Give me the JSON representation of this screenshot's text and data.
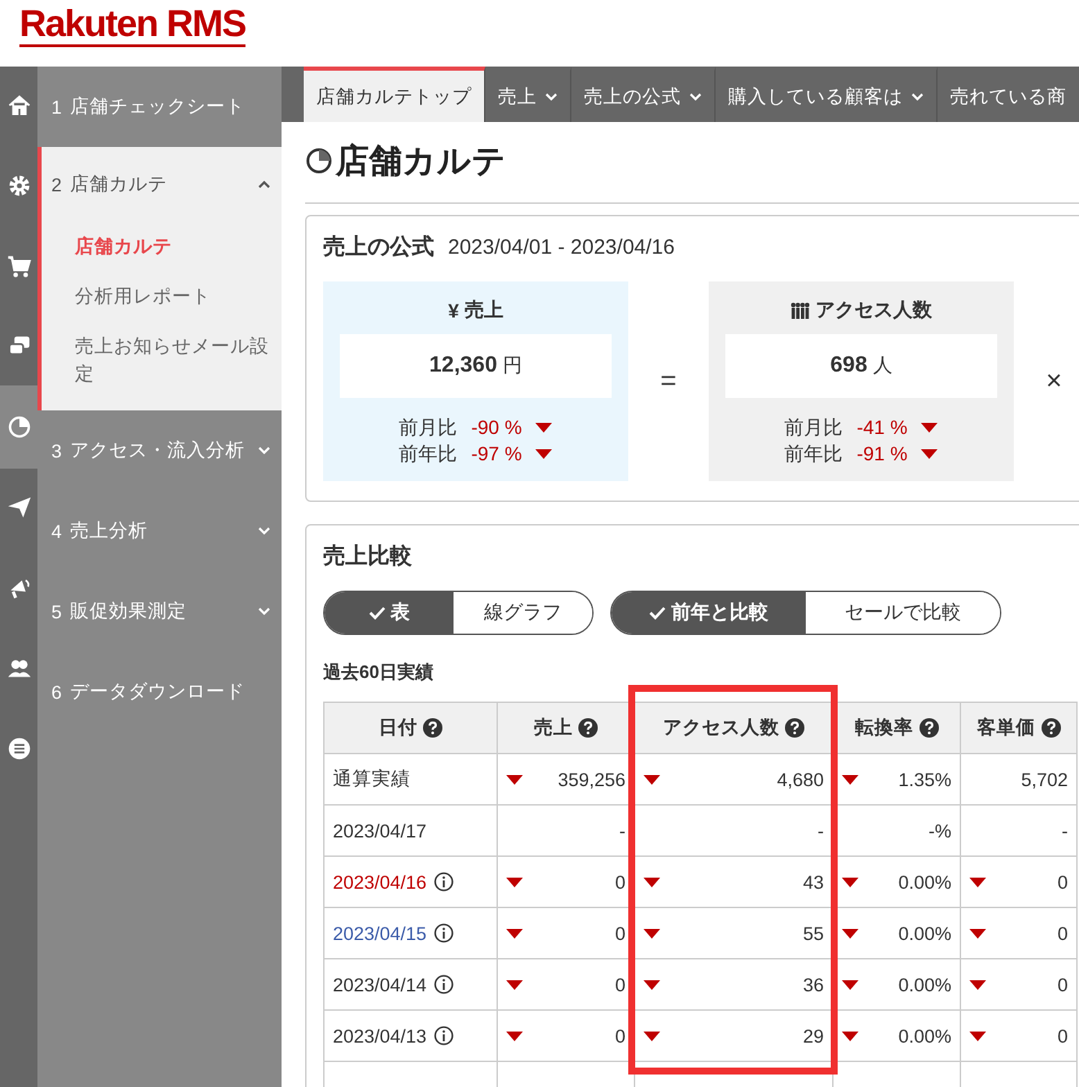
{
  "header": {
    "logo": "Rakuten RMS"
  },
  "rail": [
    {
      "kind": "home",
      "selected": false
    },
    {
      "kind": "gear",
      "selected": false
    },
    {
      "kind": "cart",
      "selected": false
    },
    {
      "kind": "chat",
      "selected": false
    },
    {
      "kind": "pie",
      "selected": true
    },
    {
      "kind": "send",
      "selected": false
    },
    {
      "kind": "megaphone",
      "selected": false
    },
    {
      "kind": "people",
      "selected": false
    },
    {
      "kind": "list",
      "selected": false
    }
  ],
  "sidebar": {
    "items": [
      {
        "number": "1",
        "label": "店舗チェックシート",
        "expanded": false,
        "has_caret": false
      },
      {
        "number": "2",
        "label": "店舗カルテ",
        "expanded": true,
        "has_caret": true,
        "children": [
          {
            "label": "店舗カルテ",
            "selected": true
          },
          {
            "label": "分析用レポート",
            "selected": false
          },
          {
            "label": "売上お知らせメール設定",
            "selected": false
          }
        ]
      },
      {
        "number": "3",
        "label": "アクセス・流入分析",
        "expanded": false,
        "has_caret": true
      },
      {
        "number": "4",
        "label": "売上分析",
        "expanded": false,
        "has_caret": true
      },
      {
        "number": "5",
        "label": "販促効果測定",
        "expanded": false,
        "has_caret": true
      },
      {
        "number": "6",
        "label": "データダウンロード",
        "expanded": false,
        "has_caret": false
      }
    ]
  },
  "tabs": [
    {
      "label": "店舗カルテトップ",
      "selected": true,
      "has_caret": false
    },
    {
      "label": "売上",
      "selected": false,
      "has_caret": true
    },
    {
      "label": "売上の公式",
      "selected": false,
      "has_caret": true
    },
    {
      "label": "購入している顧客は",
      "selected": false,
      "has_caret": true
    },
    {
      "label": "売れている商",
      "selected": false,
      "has_caret": false
    }
  ],
  "page_title": "店舗カルテ",
  "formula": {
    "title": "売上の公式",
    "period": "2023/04/01 - 2023/04/16",
    "boxes": [
      {
        "kind": "sales",
        "icon": "¥",
        "label": "売上",
        "value": "12,360",
        "unit": "円",
        "ratios": [
          {
            "label": "前月比",
            "value": "-90 %",
            "down": true
          },
          {
            "label": "前年比",
            "value": "-97 %",
            "down": true
          }
        ]
      },
      {
        "kind": "access",
        "label": "アクセス人数",
        "value": "698",
        "unit": "人",
        "ratios": [
          {
            "label": "前月比",
            "value": "-41 %",
            "down": true
          },
          {
            "label": "前年比",
            "value": "-91 %",
            "down": true
          }
        ]
      }
    ],
    "operators": [
      "=",
      "×"
    ]
  },
  "comparison": {
    "title": "売上比較",
    "view_toggle": [
      {
        "label": "表",
        "selected": true
      },
      {
        "label": "線グラフ",
        "selected": false
      }
    ],
    "compare_toggle": [
      {
        "label": "前年と比較",
        "selected": true
      },
      {
        "label": "セールで比較",
        "selected": false
      }
    ],
    "subtitle": "過去60日実績",
    "table": {
      "columns": [
        {
          "label": "日付",
          "highlighted": false
        },
        {
          "label": "売上",
          "highlighted": false
        },
        {
          "label": "アクセス人数",
          "highlighted": true
        },
        {
          "label": "転換率",
          "highlighted": false
        },
        {
          "label": "客単価",
          "highlighted": false
        }
      ],
      "rows": [
        {
          "kind": "total",
          "info": false,
          "cells": [
            {
              "value": "通算実績"
            },
            {
              "value": "359,256",
              "down": true
            },
            {
              "value": "4,680",
              "down": true
            },
            {
              "value": "1.35%",
              "down": true
            },
            {
              "value": "5,702",
              "down": false
            }
          ]
        },
        {
          "kind": "weekday",
          "info": false,
          "cells": [
            {
              "value": "2023/04/17"
            },
            {
              "value": "-",
              "down": false
            },
            {
              "value": "-",
              "down": false
            },
            {
              "value": "-%",
              "down": false
            },
            {
              "value": "-",
              "down": false
            }
          ]
        },
        {
          "kind": "sunday",
          "info": true,
          "cells": [
            {
              "value": "2023/04/16"
            },
            {
              "value": "0",
              "down": true
            },
            {
              "value": "43",
              "down": true
            },
            {
              "value": "0.00%",
              "down": true
            },
            {
              "value": "0",
              "down": true
            }
          ]
        },
        {
          "kind": "saturday",
          "info": true,
          "cells": [
            {
              "value": "2023/04/15"
            },
            {
              "value": "0",
              "down": true
            },
            {
              "value": "55",
              "down": true
            },
            {
              "value": "0.00%",
              "down": true
            },
            {
              "value": "0",
              "down": true
            }
          ]
        },
        {
          "kind": "weekday",
          "info": true,
          "cells": [
            {
              "value": "2023/04/14"
            },
            {
              "value": "0",
              "down": true
            },
            {
              "value": "36",
              "down": true
            },
            {
              "value": "0.00%",
              "down": true
            },
            {
              "value": "0",
              "down": true
            }
          ]
        },
        {
          "kind": "weekday",
          "info": true,
          "cells": [
            {
              "value": "2023/04/13"
            },
            {
              "value": "0",
              "down": true
            },
            {
              "value": "29",
              "down": true
            },
            {
              "value": "0.00%",
              "down": true
            },
            {
              "value": "0",
              "down": true
            }
          ]
        }
      ]
    }
  }
}
